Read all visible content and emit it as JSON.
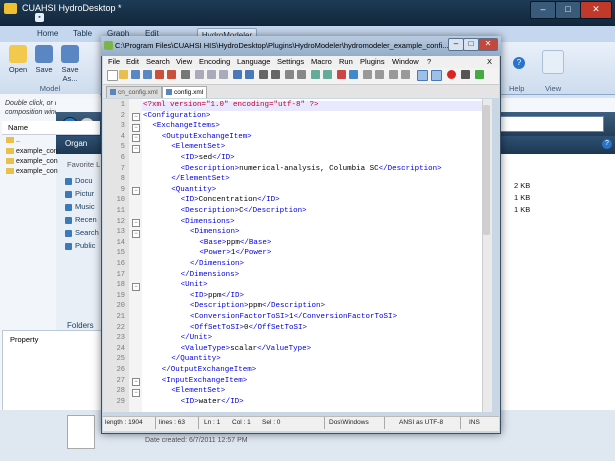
{
  "app": {
    "title": "CUAHSI HydroDesktop *",
    "quick_access_icon": "save-icon",
    "tabs": [
      "Home",
      "Table",
      "Graph",
      "Edit",
      "HydroModeler"
    ],
    "ribbon_buttons": [
      "Open",
      "Save",
      "Save As..."
    ],
    "group_model": "Model",
    "group_help": "Help",
    "group_view": "View",
    "hint": "Double click, or d... composition wind...",
    "name_header": "Name",
    "files": [
      "..",
      "example_con",
      "example_con",
      "example_con"
    ],
    "property_label": "Property",
    "date_created": "Date created: 6/7/2011 12:57 PM"
  },
  "explorer": {
    "organize": "Organ",
    "favorite_links": "Favorite L",
    "nav_items": [
      "Docu",
      "Pictur",
      "Music",
      "Recen",
      "Search",
      "Public"
    ],
    "folders": "Folders",
    "sizes": [
      "2 KB",
      "1 KB",
      "1 KB"
    ]
  },
  "npp": {
    "title": "C:\\Program Files\\CUAHSI HIS\\HydroDesktop\\Plugins\\HydroModeler\\hydromodeler_example_confi...",
    "menu": [
      "File",
      "Edit",
      "Search",
      "View",
      "Encoding",
      "Language",
      "Settings",
      "Macro",
      "Run",
      "Plugins",
      "Window",
      "?"
    ],
    "close_x": "X",
    "tabs": [
      "cn_config.xml",
      "config.xml"
    ],
    "lines": [
      {
        "n": "1",
        "indent": 0,
        "pre": "",
        "tag": "<?xml version=\"1.0\" encoding=\"utf-8\" ?>",
        "text": "",
        "post": "",
        "pi": true
      },
      {
        "n": "2",
        "indent": 0,
        "tag": "<Configuration>",
        "text": "",
        "post": ""
      },
      {
        "n": "3",
        "indent": 1,
        "tag": "<ExchangeItems>",
        "text": "",
        "post": ""
      },
      {
        "n": "4",
        "indent": 2,
        "tag": "<OutputExchangeItem>",
        "text": "",
        "post": ""
      },
      {
        "n": "5",
        "indent": 3,
        "tag": "<ElementSet>",
        "text": "",
        "post": ""
      },
      {
        "n": "6",
        "indent": 4,
        "tag": "<ID>",
        "text": "sed",
        "post": "</ID>"
      },
      {
        "n": "7",
        "indent": 4,
        "tag": "<Description>",
        "text": "numerical-analysis, Columbia SC",
        "post": "</Description>"
      },
      {
        "n": "8",
        "indent": 3,
        "tag": "</ElementSet>",
        "text": "",
        "post": ""
      },
      {
        "n": "9",
        "indent": 3,
        "tag": "<Quantity>",
        "text": "",
        "post": ""
      },
      {
        "n": "10",
        "indent": 4,
        "tag": "<ID>",
        "text": "Concentration",
        "post": "</ID>"
      },
      {
        "n": "11",
        "indent": 4,
        "tag": "<Description>",
        "text": "C",
        "post": "</Description>"
      },
      {
        "n": "12",
        "indent": 4,
        "tag": "<Dimensions>",
        "text": "",
        "post": ""
      },
      {
        "n": "13",
        "indent": 5,
        "tag": "<Dimension>",
        "text": "",
        "post": ""
      },
      {
        "n": "14",
        "indent": 6,
        "tag": "<Base>",
        "text": "ppm",
        "post": "</Base>"
      },
      {
        "n": "15",
        "indent": 6,
        "tag": "<Power>",
        "text": "1",
        "post": "</Power>"
      },
      {
        "n": "16",
        "indent": 5,
        "tag": "</Dimension>",
        "text": "",
        "post": ""
      },
      {
        "n": "17",
        "indent": 4,
        "tag": "</Dimensions>",
        "text": "",
        "post": ""
      },
      {
        "n": "18",
        "indent": 4,
        "tag": "<Unit>",
        "text": "",
        "post": ""
      },
      {
        "n": "19",
        "indent": 5,
        "tag": "<ID>",
        "text": "ppm",
        "post": "</ID>"
      },
      {
        "n": "20",
        "indent": 5,
        "tag": "<Description>",
        "text": "ppm",
        "post": "</Description>"
      },
      {
        "n": "21",
        "indent": 5,
        "tag": "<ConversionFactorToSI>",
        "text": "1",
        "post": "</ConversionFactorToSI>"
      },
      {
        "n": "22",
        "indent": 5,
        "tag": "<OffSetToSI>",
        "text": "0",
        "post": "</OffSetToSI>"
      },
      {
        "n": "23",
        "indent": 4,
        "tag": "</Unit>",
        "text": "",
        "post": ""
      },
      {
        "n": "24",
        "indent": 4,
        "tag": "<ValueType>",
        "text": "scalar",
        "post": "</ValueType>"
      },
      {
        "n": "25",
        "indent": 3,
        "tag": "</Quantity>",
        "text": "",
        "post": ""
      },
      {
        "n": "26",
        "indent": 2,
        "tag": "</OutputExchangeItem>",
        "text": "",
        "post": ""
      },
      {
        "n": "27",
        "indent": 2,
        "tag": "<InputExchangeItem>",
        "text": "",
        "post": ""
      },
      {
        "n": "28",
        "indent": 3,
        "tag": "<ElementSet>",
        "text": "",
        "post": ""
      },
      {
        "n": "29",
        "indent": 4,
        "tag": "<ID>",
        "text": "water",
        "post": "</ID>"
      }
    ],
    "status": {
      "length": "length : 1904",
      "lines": "lines : 63",
      "ln": "Ln : 1",
      "col": "Col : 1",
      "sel": "Sel : 0",
      "eol": "Dos\\Windows",
      "encoding": "ANSI as UTF-8",
      "mode": "INS"
    }
  },
  "colors": {
    "tag": "#0000e0",
    "text": "#000000",
    "pi": "#c00030"
  }
}
